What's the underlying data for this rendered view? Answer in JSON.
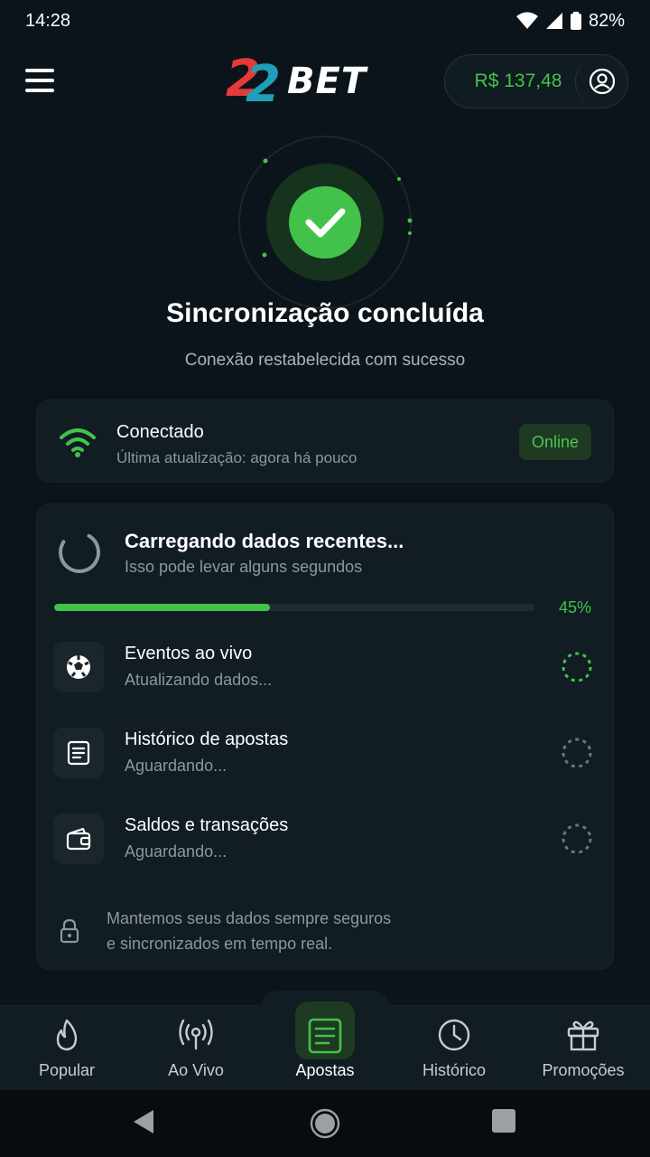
{
  "status_bar": {
    "time": "14:28",
    "battery": "82%"
  },
  "header": {
    "logo_digits": "22",
    "logo_text": "BET",
    "balance": "R$ 137,48"
  },
  "hero": {
    "title": "Sincronização concluída",
    "subtitle": "Conexão restabelecida com sucesso"
  },
  "connection": {
    "title": "Conectado",
    "subtitle": "Última atualização: agora há pouco",
    "badge": "Online"
  },
  "loading": {
    "title": "Carregando dados recentes...",
    "subtitle": "Isso pode levar alguns segundos",
    "progress": 45,
    "progress_label": "45%",
    "tasks": [
      {
        "title": "Eventos ao vivo",
        "subtitle": "Atualizando dados...",
        "icon": "soccer-ball-icon",
        "state": "active"
      },
      {
        "title": "Histórico de apostas",
        "subtitle": "Aguardando...",
        "icon": "document-icon",
        "state": "pending"
      },
      {
        "title": "Saldos e transações",
        "subtitle": "Aguardando...",
        "icon": "wallet-icon",
        "state": "pending"
      }
    ],
    "secure_line1": "Mantemos seus dados sempre seguros",
    "secure_line2": "e sincronizados em tempo real."
  },
  "bottom_nav": [
    {
      "label": "Popular",
      "icon": "flame-icon"
    },
    {
      "label": "Ao Vivo",
      "icon": "broadcast-icon"
    },
    {
      "label": "Apostas",
      "icon": "betslip-icon",
      "active": true
    },
    {
      "label": "Histórico",
      "icon": "clock-icon"
    },
    {
      "label": "Promoções",
      "icon": "gift-icon"
    }
  ],
  "colors": {
    "accent": "#43c24b",
    "background": "#0b141a",
    "card": "#111c23"
  }
}
